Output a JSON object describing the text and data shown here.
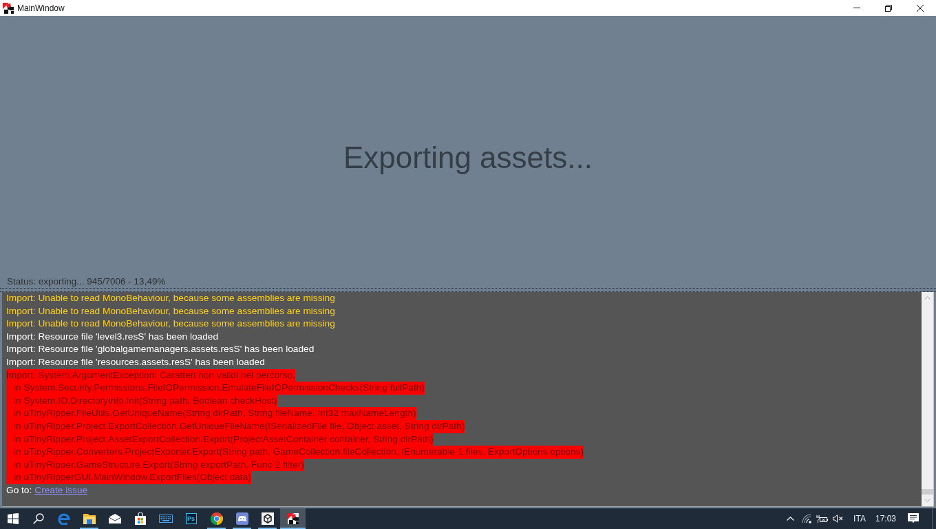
{
  "window": {
    "title": "MainWindow"
  },
  "export": {
    "heading": "Exporting assets...",
    "status": "Status: exporting... 945/7006 - 13,49%"
  },
  "log": {
    "lines": [
      {
        "kind": "warning",
        "text": "Import: Unable to read MonoBehaviour, because some assemblies are missing"
      },
      {
        "kind": "warning",
        "text": "Import: Unable to read MonoBehaviour, because some assemblies are missing"
      },
      {
        "kind": "warning",
        "text": "Import: Unable to read MonoBehaviour, because some assemblies are missing"
      },
      {
        "kind": "info",
        "text": "Import: Resource file 'level3.resS' has been loaded"
      },
      {
        "kind": "info",
        "text": "Import: Resource file 'globalgamemanagers.assets.resS' has been loaded"
      },
      {
        "kind": "info",
        "text": "Import: Resource file 'resources.assets.resS' has been loaded"
      },
      {
        "kind": "error",
        "text": "Import: System.ArgumentException: Caratteri non validi nel percorso."
      },
      {
        "kind": "trace",
        "text": "in System.Security.Permissions.FileIOPermission.EmulateFileIOPermissionChecks(String fullPath)"
      },
      {
        "kind": "trace",
        "text": "in System.IO.DirectoryInfo.Init(String path, Boolean checkHost)"
      },
      {
        "kind": "trace",
        "text": "in uTinyRipper.FileUtils.GetUniqueName(String dirPath, String fileName, Int32 maxNameLength)"
      },
      {
        "kind": "trace",
        "text": "in uTinyRipper.Project.ExportCollection.GetUniqueFileName(ISerializedFile file, Object asset, String dirPath)"
      },
      {
        "kind": "trace",
        "text": "in uTinyRipper.Project.AssetExportCollection.Export(ProjectAssetContainer container, String dirPath)"
      },
      {
        "kind": "trace",
        "text": "in uTinyRipper.Converters.ProjectExporter.Export(String path, GameCollection fileCollection, IEnumerable`1 files, ExportOptions options)"
      },
      {
        "kind": "trace",
        "text": "in uTinyRipper.GameStructure.Export(String exportPath, Func`2 filter)"
      },
      {
        "kind": "trace",
        "text": "in uTinyRipperGUI.MainWindow.ExportFiles(Object data)"
      }
    ],
    "footer": {
      "label": "Go to:",
      "link": "Create issue"
    }
  },
  "taskbar": {
    "apps": [
      {
        "running": false,
        "selected": false
      },
      {
        "running": true,
        "selected": false
      },
      {
        "running": false,
        "selected": false
      },
      {
        "running": false,
        "selected": false
      },
      {
        "running": false,
        "selected": false
      },
      {
        "text": "Ps",
        "running": false,
        "selected": false
      },
      {
        "running": true,
        "selected": false
      },
      {
        "running": true,
        "selected": false
      },
      {
        "running": true,
        "selected": false
      },
      {
        "running": true,
        "selected": true
      }
    ],
    "language": "ITA",
    "time": "17:03"
  }
}
